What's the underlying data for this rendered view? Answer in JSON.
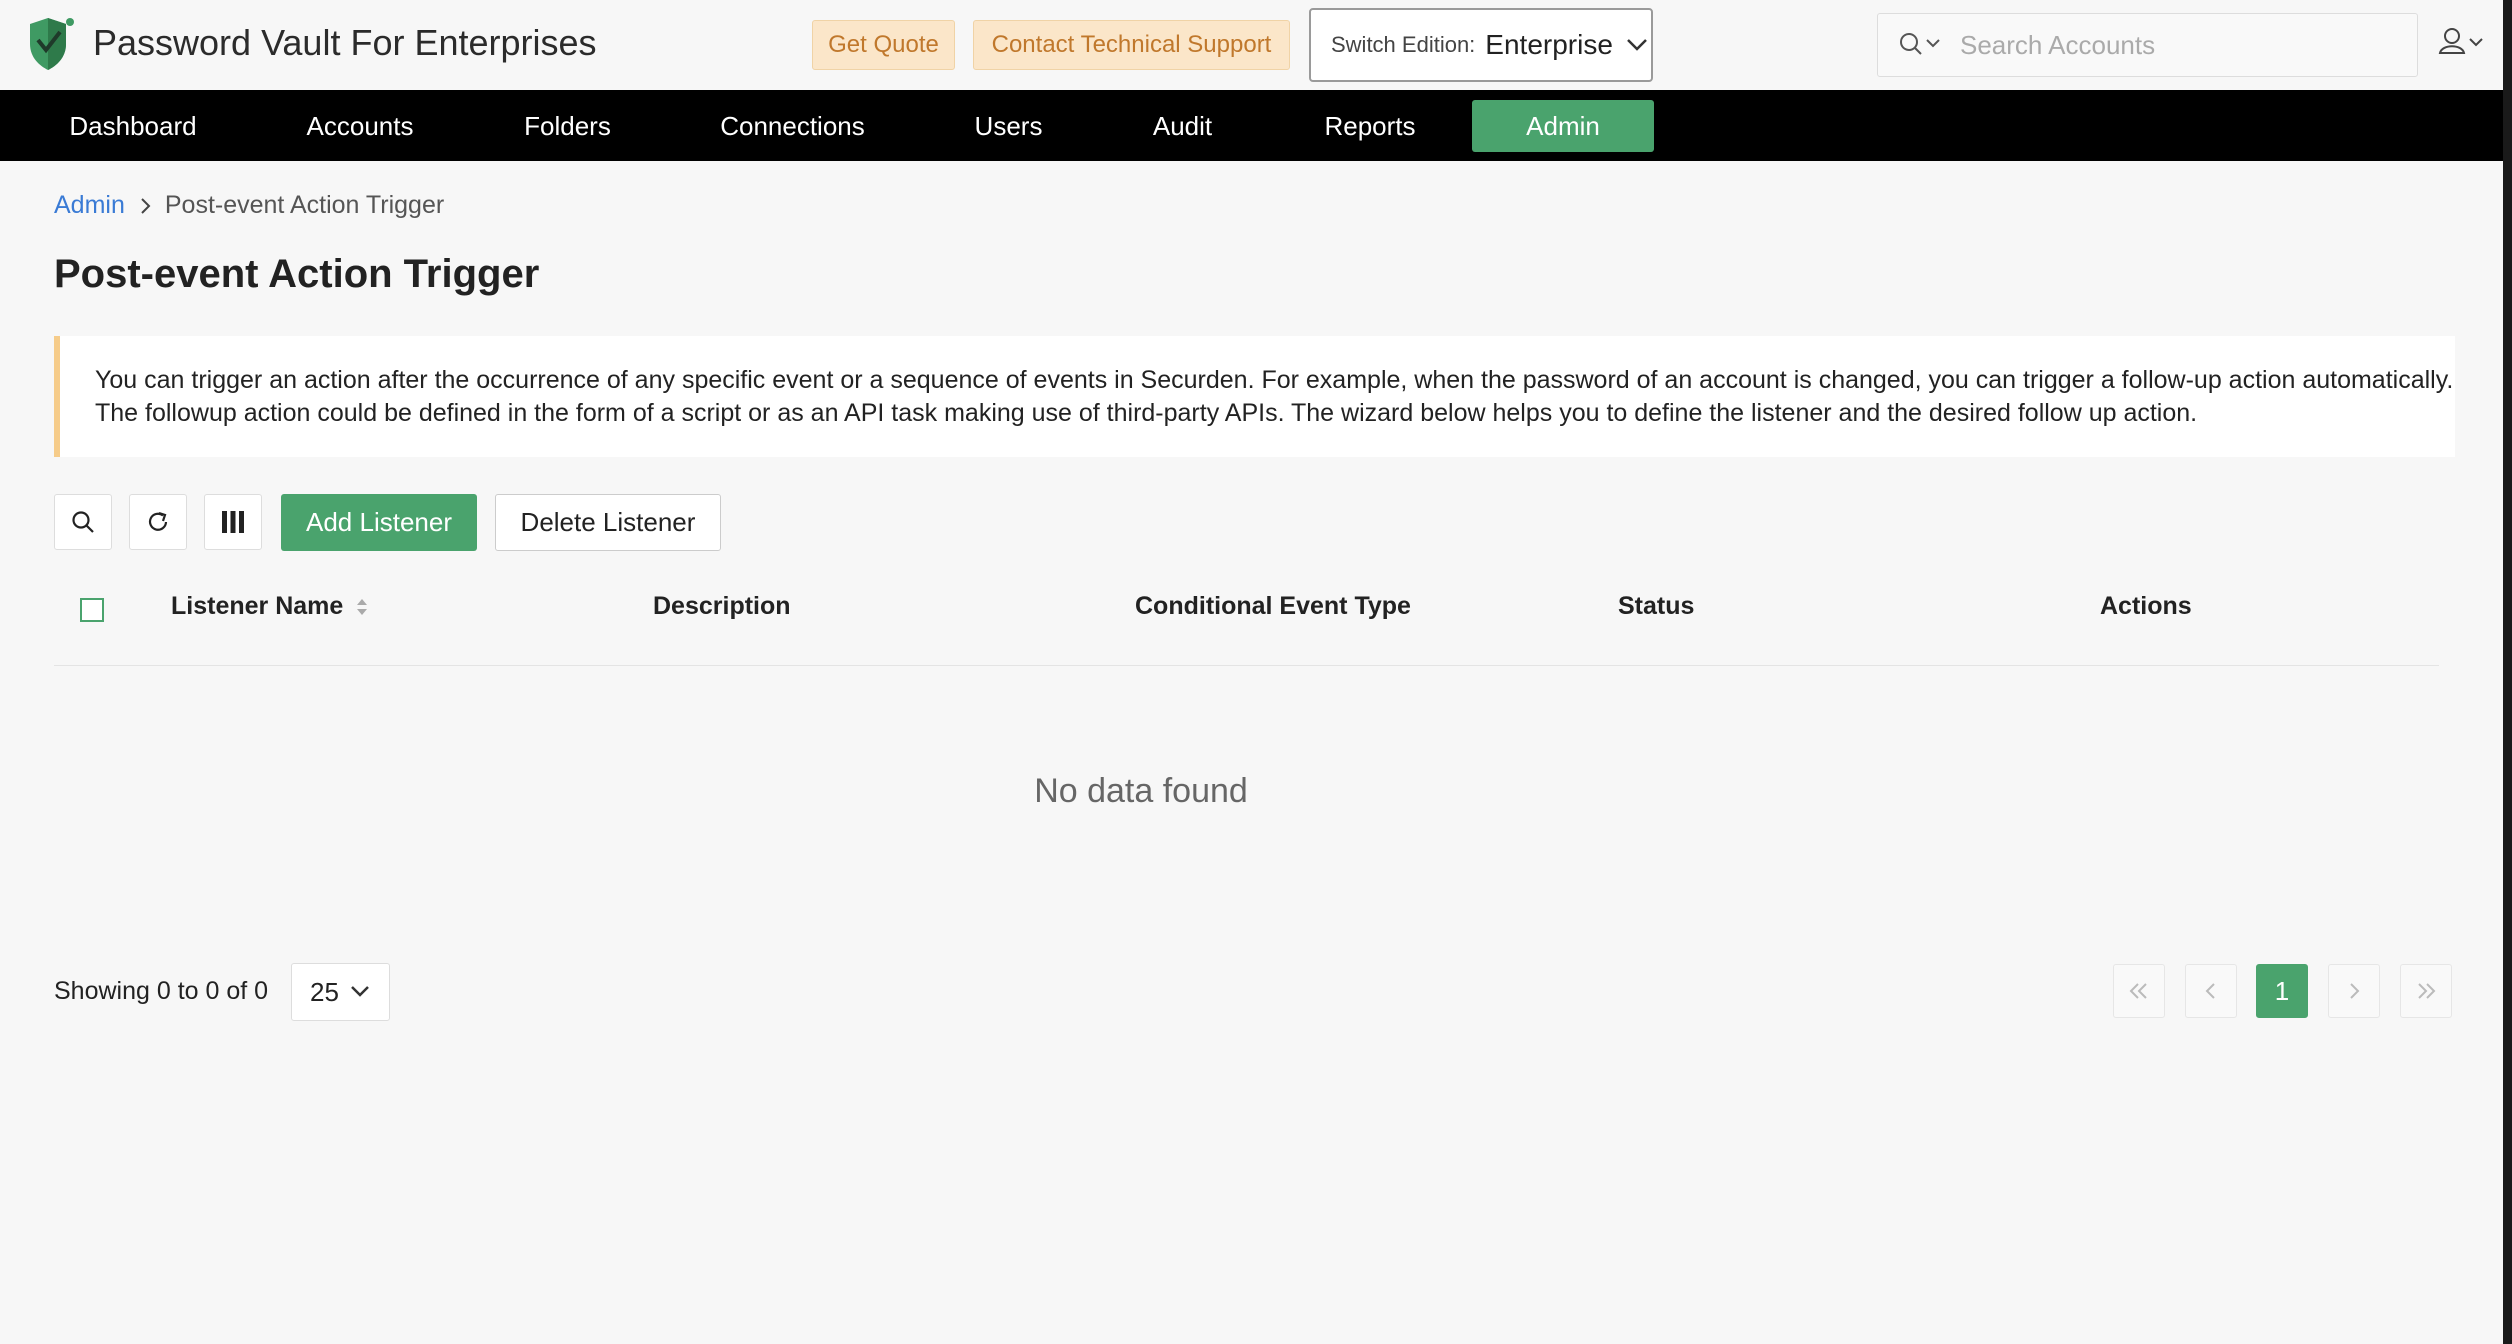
{
  "header": {
    "app_title": "Password Vault For Enterprises",
    "get_quote": "Get Quote",
    "contact_support": "Contact Technical Support",
    "edition_label": "Switch Edition:",
    "edition_value": "Enterprise",
    "search_placeholder": "Search Accounts"
  },
  "nav": {
    "items": [
      "Dashboard",
      "Accounts",
      "Folders",
      "Connections",
      "Users",
      "Audit",
      "Reports",
      "Admin"
    ],
    "active": "Admin"
  },
  "breadcrumb": {
    "parent": "Admin",
    "current": "Post-event Action Trigger"
  },
  "page_title": "Post-event Action Trigger",
  "info_text": "You can trigger an action after the occurrence of any specific event or a sequence of events in Securden. For example, when the password of an account is changed, you can trigger a follow-up action automatically. The followup action could be defined in the form of a script or as an API task making use of third-party APIs. The wizard below helps you to define the listener and the desired follow up action.",
  "toolbar": {
    "add_label": "Add Listener",
    "delete_label": "Delete Listener"
  },
  "table": {
    "columns": [
      "Listener Name",
      "Description",
      "Conditional Event Type",
      "Status",
      "Actions"
    ],
    "rows": [],
    "empty_text": "No data found"
  },
  "footer": {
    "showing": "Showing 0 to 0 of 0",
    "page_size": "25",
    "current_page": "1"
  },
  "colors": {
    "accent": "#4aa36d",
    "nav_bg": "#000000",
    "quote_bg": "#fbe6c9",
    "info_border": "#f6cc8a"
  }
}
